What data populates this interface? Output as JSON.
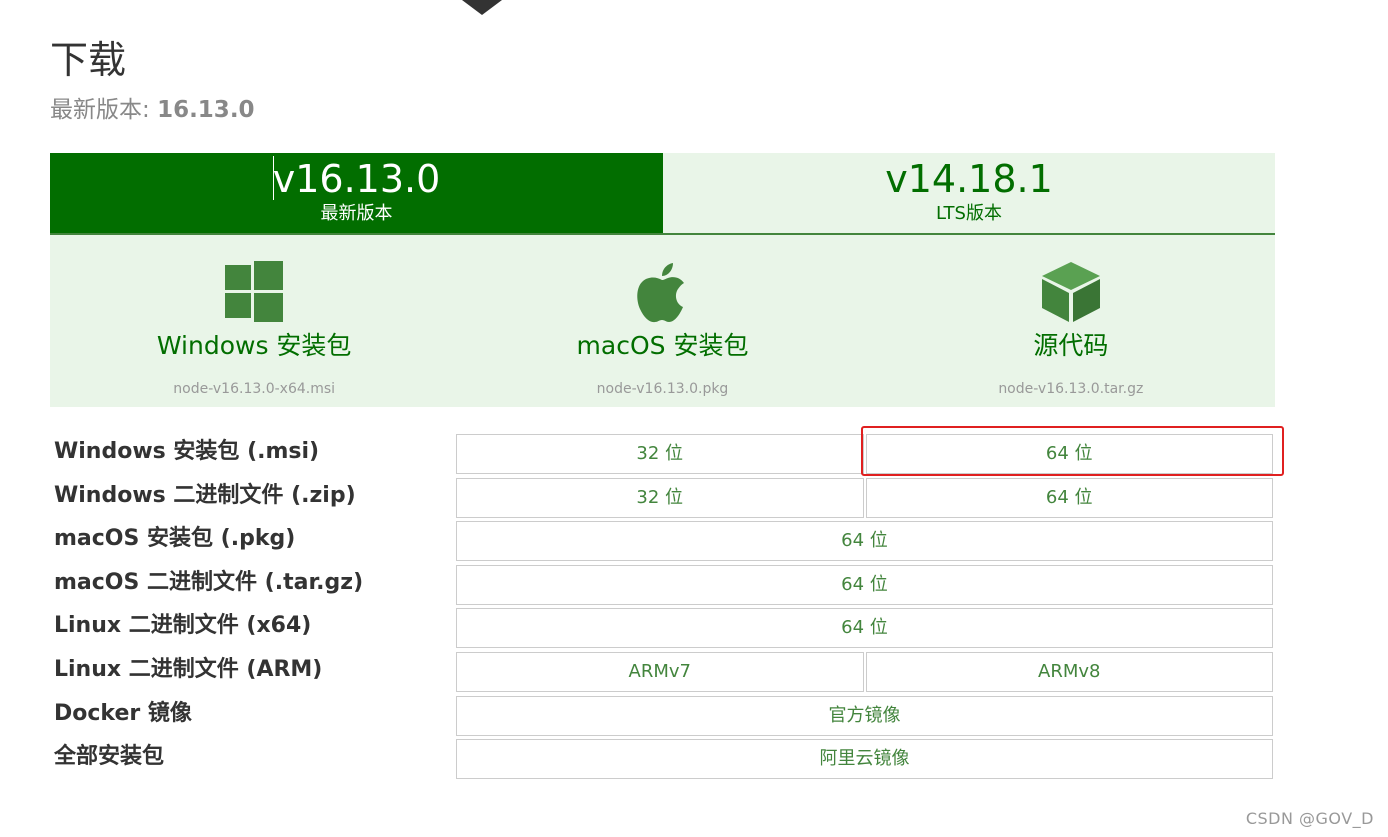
{
  "page": {
    "title": "下载",
    "latest_label": "最新版本: ",
    "latest_version": "16.13.0"
  },
  "tabs": [
    {
      "version": "v16.13.0",
      "label": "最新版本"
    },
    {
      "version": "v14.18.1",
      "label": "LTS版本"
    }
  ],
  "cards": [
    {
      "icon": "windows-icon",
      "label": "Windows 安装包",
      "file": "node-v16.13.0-x64.msi"
    },
    {
      "icon": "apple-icon",
      "label": "macOS 安装包",
      "file": "node-v16.13.0.pkg"
    },
    {
      "icon": "cube-icon",
      "label": "源代码",
      "file": "node-v16.13.0.tar.gz"
    }
  ],
  "rows": [
    {
      "label": "Windows 安装包 (.msi)",
      "cells": [
        "32 位",
        "64 位"
      ]
    },
    {
      "label": "Windows 二进制文件 (.zip)",
      "cells": [
        "32 位",
        "64 位"
      ]
    },
    {
      "label": "macOS 安装包 (.pkg)",
      "cells": [
        "64 位"
      ]
    },
    {
      "label": "macOS 二进制文件 (.tar.gz)",
      "cells": [
        "64 位"
      ]
    },
    {
      "label": "Linux 二进制文件 (x64)",
      "cells": [
        "64 位"
      ]
    },
    {
      "label": "Linux 二进制文件 (ARM)",
      "cells": [
        "ARMv7",
        "ARMv8"
      ]
    },
    {
      "label": "Docker 镜像",
      "cells": [
        "官方镜像"
      ]
    },
    {
      "label": "全部安装包",
      "cells": [
        "阿里云镜像"
      ]
    }
  ],
  "watermark": "CSDN @GOV_D",
  "colors": {
    "brand_dark_green": "#026e00",
    "brand_green": "#43853d",
    "panel_light_green": "#e9f5e8",
    "highlight_red": "#e02020"
  }
}
